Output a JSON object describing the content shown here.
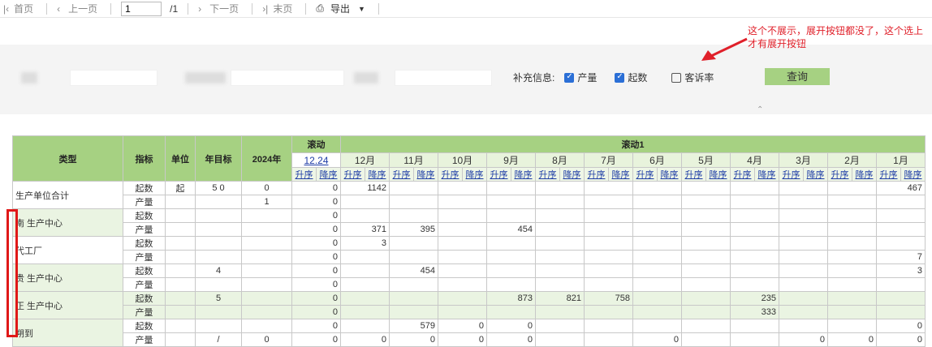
{
  "toolbar": {
    "first": "首页",
    "prev": "上一页",
    "page_value": "1",
    "page_total": "/1",
    "next": "下一页",
    "last": "末页",
    "export": "导出"
  },
  "filter": {
    "supplement_label": "补充信息:",
    "options": [
      {
        "label": "产量",
        "checked": true
      },
      {
        "label": "起数",
        "checked": true
      },
      {
        "label": "客诉率",
        "checked": false
      }
    ],
    "query_button": "查询"
  },
  "annotation": {
    "text": "这个不展示，展开按钮都没了，这个选上才有展开按钮",
    "color": "#e0202a"
  },
  "table": {
    "headers": {
      "type": "类型",
      "metric": "指标",
      "unit": "单位",
      "annual_target": "年目标",
      "year": "2024年",
      "rolling_a": "滚动",
      "rolling_b": "滚动1",
      "day_col": "12.24",
      "months": [
        "12月",
        "11月",
        "10月",
        "9月",
        "8月",
        "7月",
        "6月",
        "5月",
        "4月",
        "3月",
        "2月",
        "1月"
      ],
      "asc": "升序",
      "desc": "降序"
    },
    "groups": [
      {
        "name": "生产单位合计",
        "rows": [
          {
            "metric": "起数",
            "unit": "起",
            "target": "5 0",
            "y2024": "0",
            "day": "0",
            "m": [
              "1142",
              "",
              "",
              "",
              "",
              "",
              "",
              "",
              "",
              "",
              "",
              "467"
            ]
          },
          {
            "metric": "产量",
            "unit": "",
            "target": "",
            "y2024": "1",
            "day": "0",
            "m": [
              "",
              "",
              "",
              "",
              "",
              "",
              "",
              "",
              "",
              "",
              "",
              ""
            ]
          }
        ]
      },
      {
        "name": "南 生产中心",
        "rows": [
          {
            "metric": "起数",
            "unit": "",
            "target": "",
            "y2024": "",
            "day": "0",
            "m": [
              "",
              "",
              "",
              "",
              "",
              "",
              "",
              "",
              "",
              "",
              "",
              ""
            ]
          },
          {
            "metric": "产量",
            "unit": "",
            "target": "",
            "y2024": "",
            "day": "0",
            "m": [
              "371",
              "395",
              "",
              "454",
              "",
              "",
              "",
              "",
              "",
              "",
              "",
              ""
            ]
          }
        ]
      },
      {
        "name": "代工厂",
        "rows": [
          {
            "metric": "起数",
            "unit": "",
            "target": "",
            "y2024": "",
            "day": "0",
            "m": [
              "3",
              "",
              "",
              "",
              "",
              "",
              "",
              "",
              "",
              "",
              "",
              ""
            ]
          },
          {
            "metric": "产量",
            "unit": "",
            "target": "",
            "y2024": "",
            "day": "0",
            "m": [
              "",
              "",
              "",
              "",
              "",
              "",
              "",
              "",
              "",
              "",
              "",
              "7"
            ]
          }
        ]
      },
      {
        "name": "贵 生产中心",
        "rows": [
          {
            "metric": "起数",
            "unit": "",
            "target": "4",
            "y2024": "",
            "day": "0",
            "m": [
              "",
              "454",
              "",
              "",
              "",
              "",
              "",
              "",
              "",
              "",
              "",
              "3"
            ]
          },
          {
            "metric": "产量",
            "unit": "",
            "target": "",
            "y2024": "",
            "day": "0",
            "m": [
              "",
              "",
              "",
              "",
              "",
              "",
              "",
              "",
              "",
              "",
              "",
              ""
            ]
          }
        ]
      },
      {
        "name": "正 生产中心",
        "rows": [
          {
            "metric": "起数",
            "unit": "",
            "target": "5",
            "y2024": "",
            "day": "0",
            "m": [
              "",
              "",
              "",
              "873",
              "821",
              "758",
              "",
              "",
              "235",
              "",
              "",
              ""
            ]
          },
          {
            "metric": "产量",
            "unit": "",
            "target": "",
            "y2024": "",
            "day": "0",
            "m": [
              "",
              "",
              "",
              "",
              "",
              "",
              "",
              "",
              "333",
              "",
              "",
              ""
            ]
          }
        ]
      },
      {
        "name": "朔到",
        "rows": [
          {
            "metric": "起数",
            "unit": "",
            "target": "",
            "y2024": "",
            "day": "0",
            "m": [
              "",
              "579",
              "0",
              "0",
              "",
              "",
              "",
              "",
              "",
              "",
              "",
              "0"
            ]
          },
          {
            "metric": "产量",
            "unit": "",
            "target": "/",
            "y2024": "0",
            "day": "0",
            "m": [
              "0",
              "0",
              "0",
              "0",
              "",
              "",
              "0",
              "",
              "",
              "0",
              "0",
              "0"
            ]
          }
        ]
      }
    ]
  }
}
